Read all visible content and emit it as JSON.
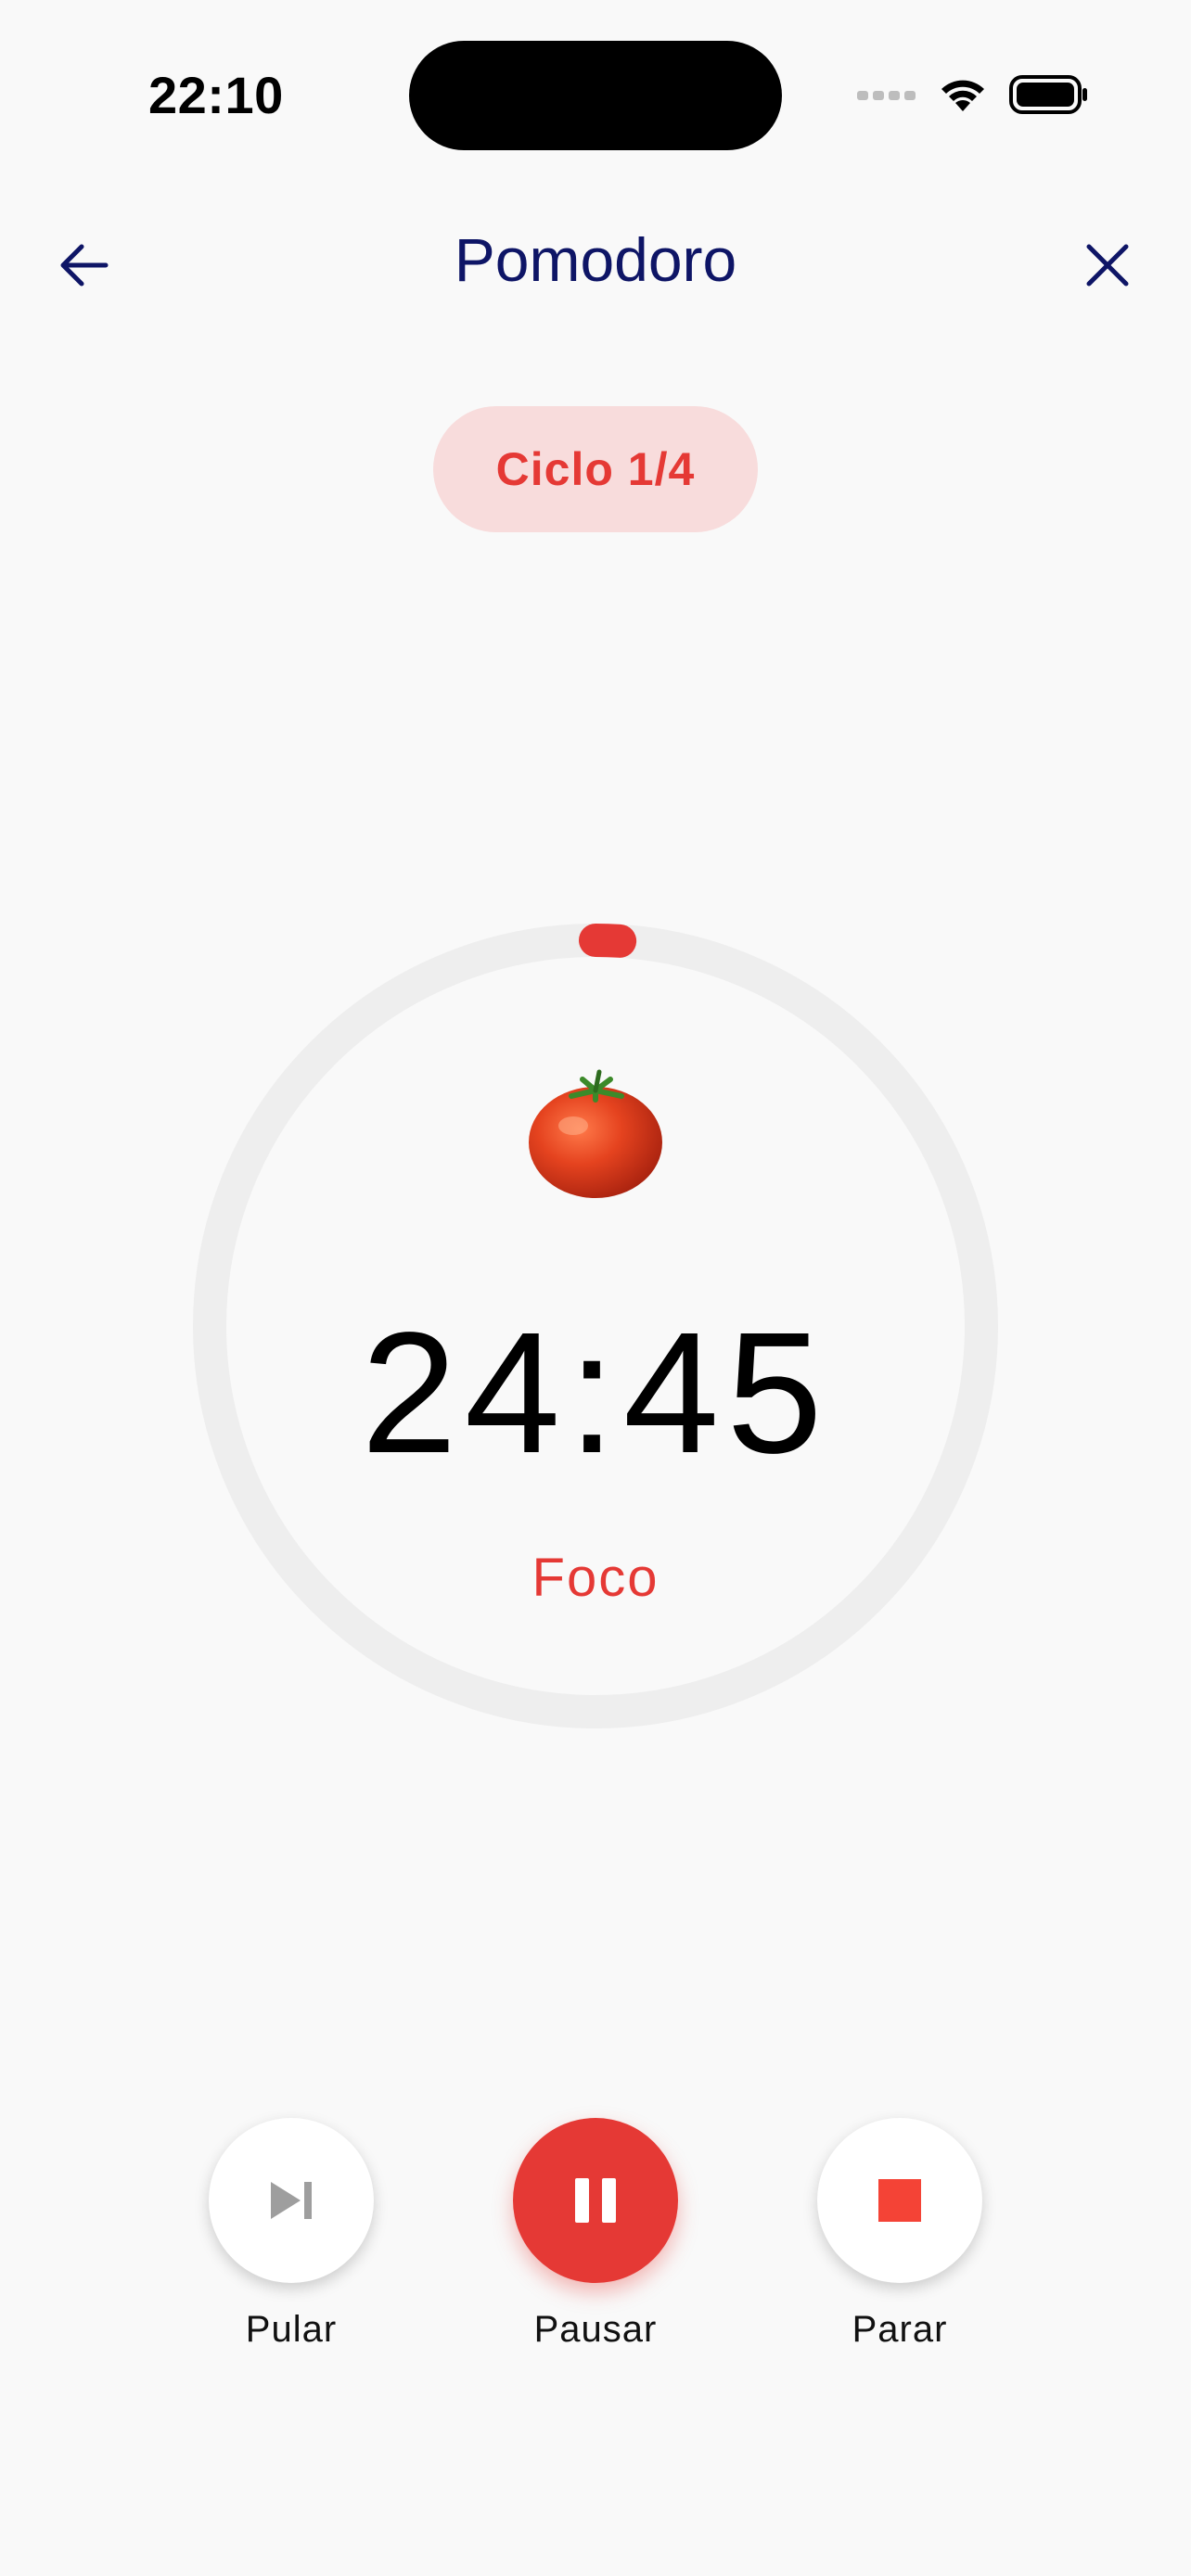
{
  "status_bar": {
    "time": "22:10"
  },
  "nav": {
    "title": "Pomodoro",
    "back_icon": "arrow-left-icon",
    "close_icon": "close-icon"
  },
  "cycle": {
    "label": "Ciclo 1/4"
  },
  "timer": {
    "time": "24:45",
    "phase": "Foco",
    "progress": 0.01,
    "icon": "tomato-icon"
  },
  "controls": {
    "skip_label": "Pular",
    "pause_label": "Pausar",
    "stop_label": "Parar"
  },
  "colors": {
    "accent": "#e53935",
    "title": "#0e1566",
    "pill_bg": "#f8dcdc",
    "ring_track": "#eeeeee",
    "background": "#f9f9f9"
  }
}
